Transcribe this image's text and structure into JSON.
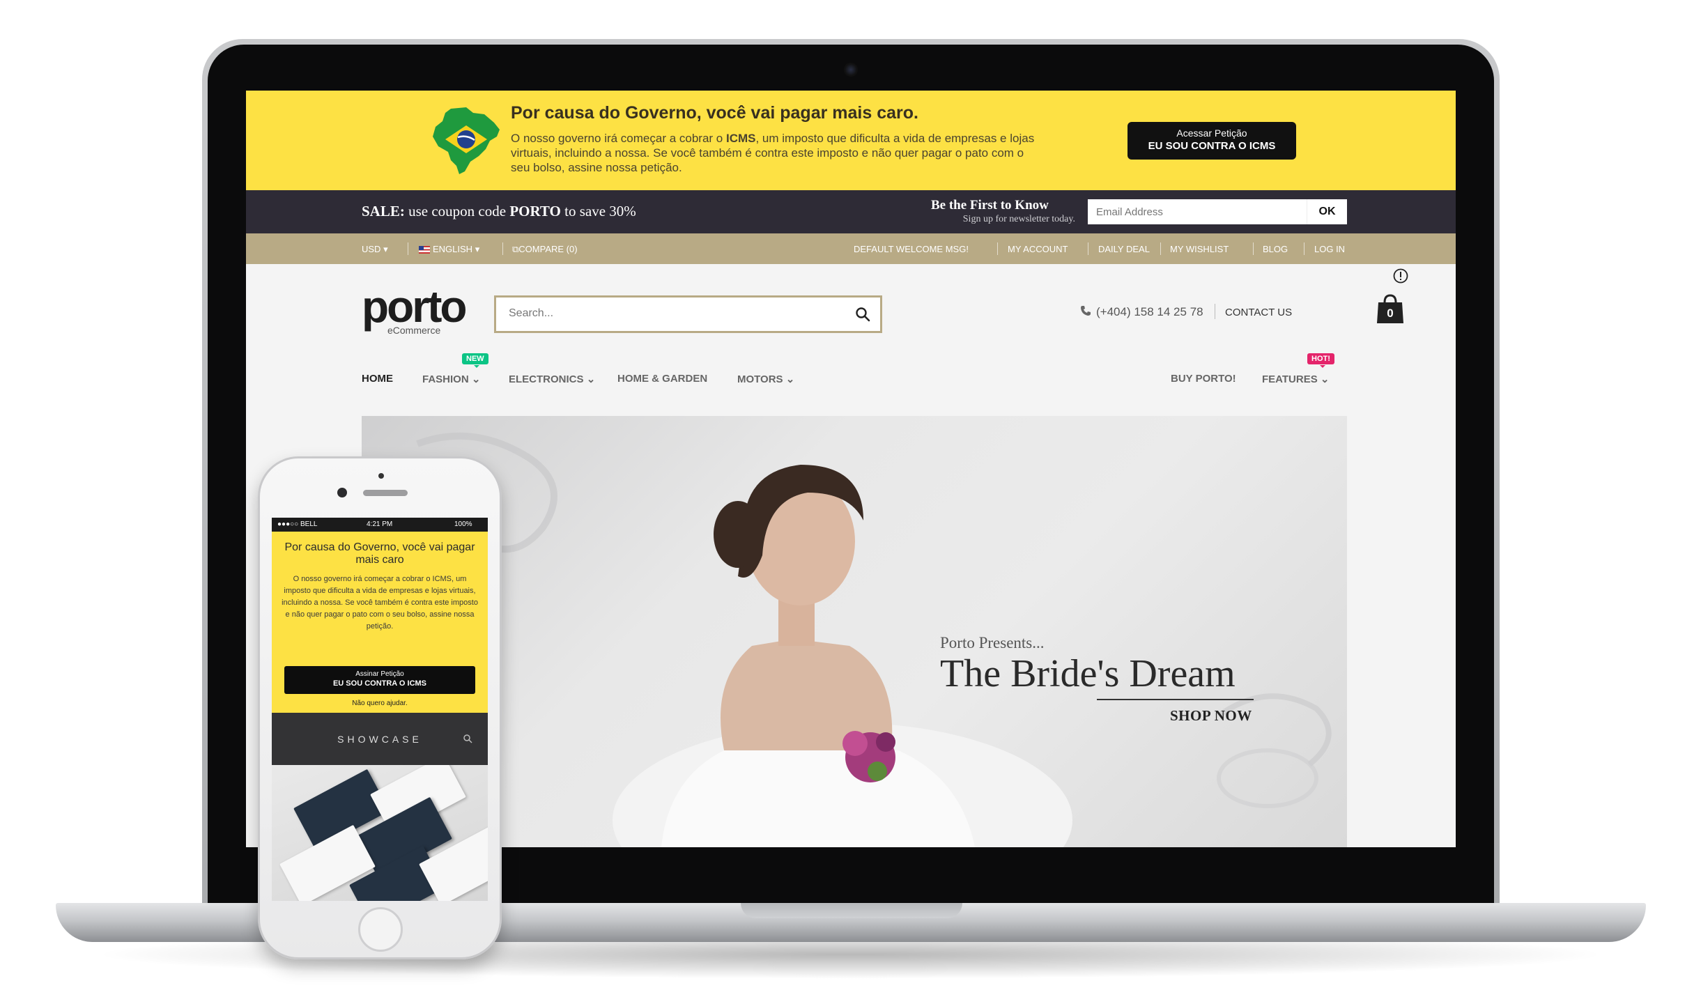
{
  "icms_banner": {
    "title": "Por causa do Governo, você vai pagar mais caro.",
    "text_before": "O nosso governo irá começar a cobrar o ",
    "text_bold": "ICMS",
    "text_after": ", um imposto que dificulta a vida de empresas e lojas virtuais, incluindo a nossa. Se você também é contra este imposto e não quer pagar o pato com o seu bolso, assine nossa petição.",
    "button_line1": "Acessar Petição",
    "button_line2": "EU SOU CONTRA O ICMS"
  },
  "sale_bar": {
    "sale_label": "SALE:",
    "sale_text_before": " use coupon code ",
    "coupon": "PORTO",
    "sale_text_after": " to save 30%",
    "newsletter_title": "Be the First to Know",
    "newsletter_sub": "Sign up for newsletter today.",
    "email_placeholder": "Email Address",
    "ok_label": "OK"
  },
  "top_links": {
    "currency": "USD",
    "language": "ENGLISH",
    "compare": "COMPARE (0)",
    "welcome": "DEFAULT WELCOME MSG!",
    "my_account": "MY ACCOUNT",
    "daily_deal": "DAILY DEAL",
    "my_wishlist": "MY WISHLIST",
    "blog": "BLOG",
    "log_in": "LOG IN"
  },
  "header": {
    "logo": "porto",
    "logo_sub": "eCommerce",
    "search_placeholder": "Search...",
    "phone": "(+404) 158 14 25 78",
    "contact": "CONTACT US",
    "cart_count": "0"
  },
  "nav": {
    "home": "HOME",
    "fashion": "FASHION",
    "fashion_badge": "NEW",
    "electronics": "ELECTRONICS",
    "home_garden": "HOME & GARDEN",
    "motors": "MOTORS",
    "buy": "BUY PORTO!",
    "features": "FEATURES",
    "features_badge": "HOT!"
  },
  "hero": {
    "pre": "Porto Presents...",
    "title": "The Bride's Dream",
    "cta": "SHOP NOW"
  },
  "mobile": {
    "carrier": "BELL",
    "time": "4:21 PM",
    "battery": "100%",
    "title": "Por causa do Governo, você vai pagar mais caro",
    "text": "O nosso governo irá começar a cobrar o ICMS, um imposto que dificulta a vida de empresas e lojas virtuais, incluindo a nossa. Se você também é contra este imposto e não quer pagar o pato com o seu bolso, assine nossa petição.",
    "button_line1": "Assinar Petição",
    "button_line2": "EU SOU CONTRA O ICMS",
    "decline": "Não quero ajudar.",
    "showcase": "SHOWCASE"
  },
  "colors": {
    "banner_yellow": "#fde144",
    "sale_bar_dark": "#2e2b36",
    "top_links_tan": "#b8aa85",
    "badge_new": "#0cc485",
    "badge_hot": "#e4246a"
  }
}
